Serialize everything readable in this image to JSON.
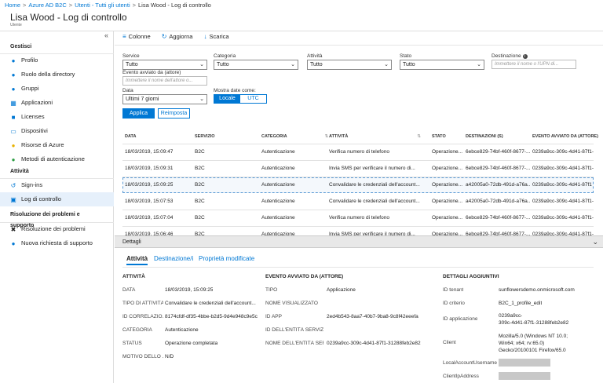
{
  "breadcrumb": [
    "Home",
    "Azure AD B2C",
    "Utenti - Tutti gli utenti",
    "Lisa Wood - Log di controllo"
  ],
  "header": {
    "title": "Lisa Wood - Log di controllo",
    "subtitle": "Utente"
  },
  "sidebar": {
    "collapse_glyph": "«",
    "sections": [
      {
        "label": "Gestisci",
        "items": [
          {
            "label": "Profilo",
            "icon": "user-icon"
          },
          {
            "label": "Ruolo della directory",
            "icon": "role-icon"
          },
          {
            "label": "Gruppi",
            "icon": "groups-icon"
          },
          {
            "label": "Applicazioni",
            "icon": "apps-icon"
          },
          {
            "label": "Licenses",
            "icon": "license-icon"
          },
          {
            "label": "Dispositivi",
            "icon": "device-icon"
          },
          {
            "label": "Risorse di Azure",
            "icon": "key-icon"
          },
          {
            "label": "Metodi di autenticazione",
            "icon": "auth-icon"
          }
        ]
      },
      {
        "label": "Attività",
        "items": [
          {
            "label": "Sign-ins",
            "icon": "signin-icon"
          },
          {
            "label": "Log di controllo",
            "icon": "audit-log-icon",
            "active": true
          }
        ]
      },
      {
        "label": "Risoluzione dei problemi e supporto",
        "items": [
          {
            "label": "Risoluzione dei problemi",
            "icon": "wrench-icon"
          },
          {
            "label": "Nuova richiesta di supporto",
            "icon": "support-icon"
          }
        ]
      }
    ]
  },
  "toolbar": {
    "columns": "Colonne",
    "refresh": "Aggiorna",
    "download": "Scarica"
  },
  "filters": {
    "service_label": "Service",
    "service_value": "Tutto",
    "category_label": "Categoria",
    "category_value": "Tutto",
    "activity_label": "Attività",
    "activity_value": "Tutto",
    "status_label": "Stato",
    "status_value": "Tutto",
    "target_label": "Destinazione",
    "target_placeholder": "Immettere il nome o l'UPN di...",
    "initiated_label": "Evento avviato da (attore)",
    "initiated_placeholder": "Immettere il nome dell'attore o...",
    "date_label": "Data",
    "date_value": "Ultimi 7 giorni",
    "show_dates_label": "Mostra date come:",
    "local": "Locale",
    "utc": "UTC",
    "apply": "Applica",
    "reset": "Reimposta"
  },
  "table": {
    "headers": [
      "DATA",
      "SERVIZIO",
      "CATEGORIA",
      "ATTIVITÀ",
      "STATO",
      "DESTINAZIONI (S)",
      "EVENTO AVVIATO DA (ATTORE)"
    ],
    "rows": [
      [
        "18/03/2019, 15:09:47",
        "B2C",
        "Autenticazione",
        "Verifica numero di telefono",
        "Operazione...",
        "6ebce829-74bf-460f-8677-...",
        "0239a9cc-309c-4d41-87f1-..."
      ],
      [
        "18/03/2019, 15:09:31",
        "B2C",
        "Autenticazione",
        "Invia SMS per verificare il numero di...",
        "Operazione...",
        "6ebce829-74bf-460f-8677-...",
        "0239a9cc-309c-4d41-87f1-..."
      ],
      [
        "18/03/2019, 15:09:25",
        "B2C",
        "Autenticazione",
        "Convalidare le credenziali dell'account...",
        "Operazione...",
        "a42005a0-72db-491d-a76a...",
        "0239a9cc-309c-4d41-87f1-..."
      ],
      [
        "18/03/2019, 15:07:53",
        "B2C",
        "Autenticazione",
        "Convalidare le credenziali dell'account...",
        "Operazione...",
        "a42005a0-72db-491d-a76a...",
        "0239a9cc-309c-4d41-87f1-..."
      ],
      [
        "18/03/2019, 15:07:04",
        "B2C",
        "Autenticazione",
        "Verifica numero di telefono",
        "Operazione...",
        "6ebce829-74bf-460f-8677-...",
        "0239a9cc-309c-4d41-87f1-..."
      ],
      [
        "18/03/2019, 15:06:46",
        "B2C",
        "Autenticazione",
        "Invia SMS per verificare il numero di...",
        "Operazione...",
        "6ebce829-74bf-460f-8677-...",
        "0239a9cc-309c-4d41-87f1-..."
      ]
    ]
  },
  "details": {
    "bar_label": "Dettagli",
    "tabs": [
      "Attività",
      "Destinazione/i",
      "Proprietà modificate"
    ],
    "activity": {
      "title": "ATTIVITÀ",
      "rows": [
        [
          "DATA",
          "18/03/2019, 15:09:25"
        ],
        [
          "TIPO DI ATTIVITÀ",
          "Convalidare le credenziali dell'account..."
        ],
        [
          "ID CORRELAZIO...",
          "8174cfdf-df35-4bbe-b2d5-9d4e948c9e5c"
        ],
        [
          "CATEGORIA",
          "Autenticazione"
        ],
        [
          "STATUS",
          "Operazione completata"
        ],
        [
          "MOTIVO DELLO ...",
          "N/D"
        ]
      ]
    },
    "initiator": {
      "title": "EVENTO AVVIATO DA (ATTORE)",
      "rows": [
        [
          "TIPO",
          "Applicazione"
        ],
        [
          "NOME VISUALIZZATO",
          ""
        ],
        [
          "ID APP",
          "2ed4b543-8aa7-40b7-9ba8-9c8f42eeefa"
        ],
        [
          "ID DELL'ENTITÀ SERVIZIO",
          ""
        ],
        [
          "NOME DELL'ENTITÀ SER...",
          "0239a9cc-309c-4d41-87f1-31288feb2e82"
        ]
      ]
    },
    "additional": {
      "title": "DETTAGLI AGGIUNTIVI",
      "tenant_key": "ID tenant",
      "tenant_val": "sunflowersdemo.onmicrosoft.com",
      "policy_key": "ID criterio",
      "policy_val": "B2C_1_profile_edit",
      "app_key": "ID applicazione",
      "app_val_1": "0239a9cc-",
      "app_val_2": "309c-4d41-87f1-31288feb2e82",
      "client_key": "Client",
      "client_val_1": "Mozilla/5.0 (Windows NT 10.0;",
      "client_val_2": "Win64; x64; rv:65.0)",
      "client_val_3": "Gecko/20100101 Firefox/65.0",
      "local_key": "LocalAccountUsername",
      "ip_key": "ClientIpAddress"
    }
  },
  "colors": {
    "accent": "#0078d4",
    "active_bg": "#e6f0fb",
    "redacted": "#c8c8c8"
  }
}
